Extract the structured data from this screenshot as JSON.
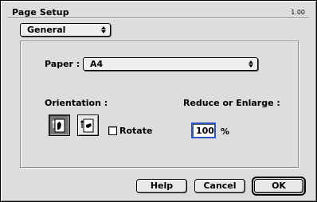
{
  "window": {
    "title": "Page Setup",
    "version": "1.00"
  },
  "section_popup": {
    "value": "General"
  },
  "paper": {
    "label": "Paper :",
    "value": "A4"
  },
  "orientation": {
    "label": "Orientation :",
    "options": [
      {
        "name": "portrait",
        "selected": true
      },
      {
        "name": "landscape",
        "selected": false
      }
    ],
    "rotate_label": "Rotate",
    "rotate_checked": false
  },
  "scale": {
    "label": "Reduce or Enlarge :",
    "value": "100",
    "unit": "%"
  },
  "buttons": {
    "help": "Help",
    "cancel": "Cancel",
    "ok": "OK"
  },
  "colors": {
    "window_bg": "#dddddd",
    "focus_ring": "#3355bb",
    "selected_option": "#777777"
  }
}
